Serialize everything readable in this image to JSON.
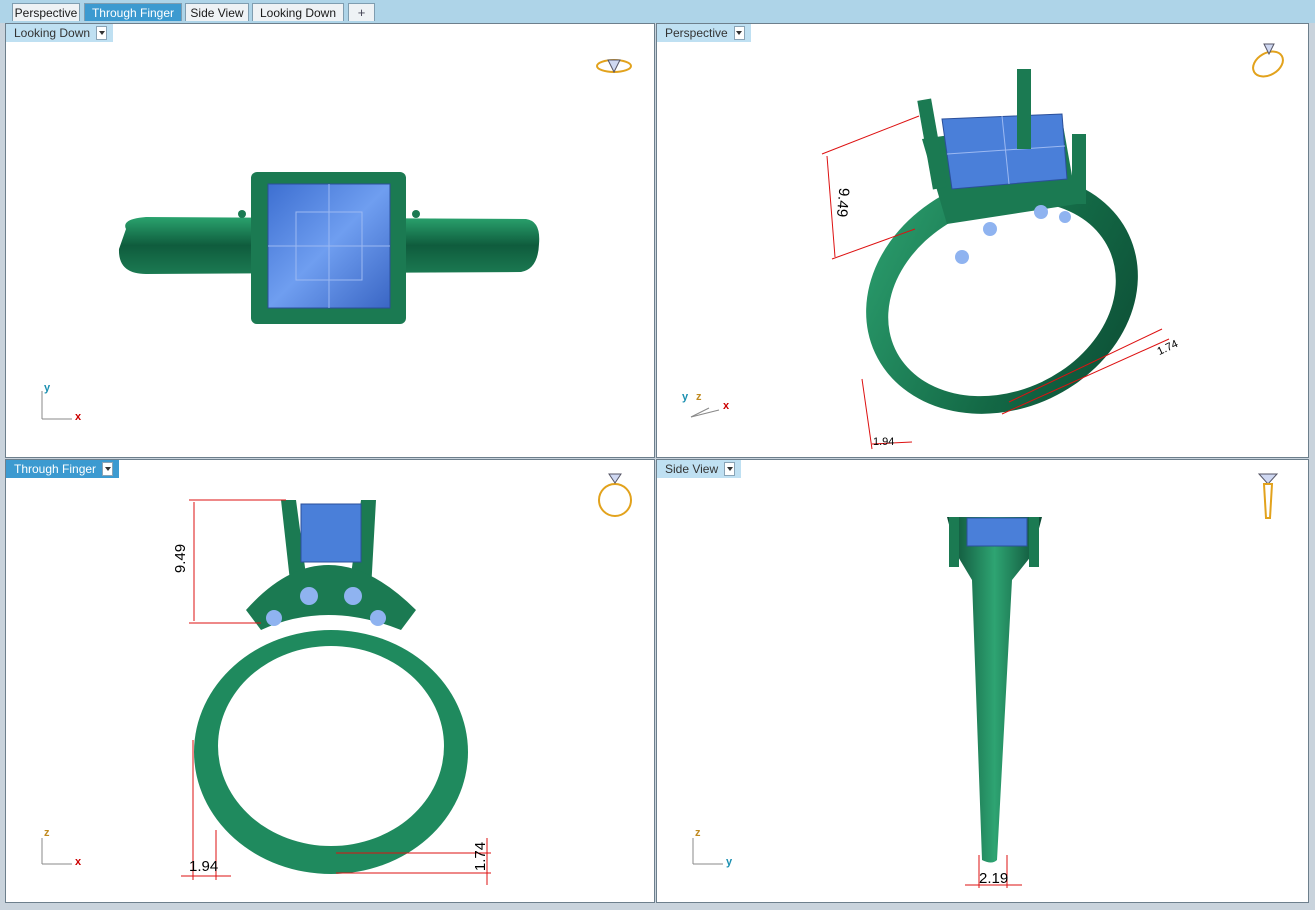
{
  "tabs": [
    {
      "label": "Perspective",
      "active": false
    },
    {
      "label": "Through Finger",
      "active": true
    },
    {
      "label": "Side View",
      "active": false
    },
    {
      "label": "Looking Down",
      "active": false
    }
  ],
  "tab_add_label": "+",
  "viewports": {
    "top_left": {
      "label": "Looking Down",
      "axis_h": "x",
      "axis_v": "y"
    },
    "top_right": {
      "label": "Perspective",
      "axis_a": "y",
      "axis_b": "z",
      "axis_c": "x",
      "dims": [
        "9.49",
        "1.74",
        "1.94"
      ]
    },
    "bottom_left": {
      "label": "Through Finger",
      "axis_h": "x",
      "axis_v": "z",
      "dims": [
        "9.49",
        "1.94",
        "1.74"
      ]
    },
    "bottom_right": {
      "label": "Side View",
      "axis_h": "y",
      "axis_v": "z",
      "dims": [
        "2.19"
      ]
    }
  },
  "colors": {
    "metal": "#1f8a5e",
    "metal_dark": "#0c4a33",
    "stone": "#4a7fd9",
    "stone_light": "#8fb3f0",
    "dimension": "#dd1111",
    "gold_icon": "#e2a21c"
  }
}
